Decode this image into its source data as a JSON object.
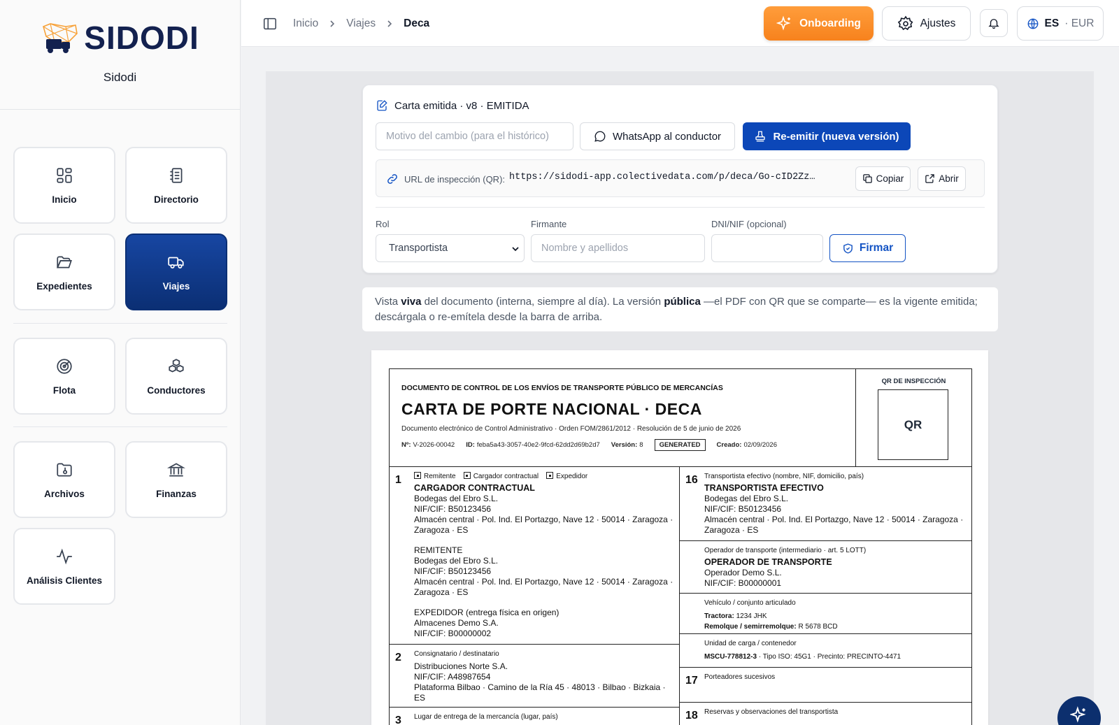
{
  "brand": {
    "name": "SIDODI",
    "org": "Sidodi"
  },
  "nav": {
    "tiles": [
      {
        "label": "Inicio",
        "icon": "dashboard-icon"
      },
      {
        "label": "Directorio",
        "icon": "directory-icon"
      },
      {
        "label": "Expedientes",
        "icon": "folder-open-icon"
      },
      {
        "label": "Viajes",
        "icon": "truck-icon",
        "active": true
      },
      {
        "label": "Flota",
        "icon": "radar-icon"
      },
      {
        "label": "Conductores",
        "icon": "boxes-icon"
      },
      {
        "label": "Archivos",
        "icon": "folder-file-icon"
      },
      {
        "label": "Finanzas",
        "icon": "bank-icon"
      },
      {
        "label": "Análisis Clientes",
        "icon": "activity-icon"
      }
    ]
  },
  "topbar": {
    "breadcrumb": [
      "Inicio",
      "Viajes",
      "Deca"
    ],
    "onboarding": "Onboarding",
    "settings": "Ajustes",
    "lang": "ES",
    "currency": "· EUR"
  },
  "card": {
    "title": "Carta emitida · v8 · EMITIDA",
    "reason_placeholder": "Motivo del cambio (para el histórico)",
    "whatsapp": "WhatsApp al conductor",
    "reissue": "Re-emitir (nueva versión)",
    "url_label": "URL de inspección (QR):",
    "url": "https://sidodi-app.colectivedata.com/p/deca/Go-cID2Zz…",
    "copy": "Copiar",
    "open": "Abrir",
    "rol_label": "Rol",
    "rol_value": "Transportista",
    "signer_label": "Firmante",
    "signer_placeholder": "Nombre y apellidos",
    "dni_label": "DNI/NIF (opcional)",
    "sign": "Firmar"
  },
  "note": {
    "t1": "Vista ",
    "b1": "viva",
    "t2": " del documento (interna, siempre al día). La versión ",
    "b2": "pública",
    "t3": " —el PDF con QR que se comparte— es la vigente emitida; descárgala o re-emítela desde la barra de arriba."
  },
  "doc": {
    "header_small": "DOCUMENTO DE CONTROL DE LOS ENVÍOS DE TRANSPORTE PÚBLICO DE MERCANCÍAS",
    "title": "CARTA DE PORTE NACIONAL · DECA",
    "desc": "Documento electrónico de Control Administrativo · Orden FOM/2861/2012 · Resolución de 5 de junio de 2026",
    "n_label": "Nº:",
    "n_value": "V-2026-00042",
    "id_label": "ID:",
    "id_value": "feba5a43-3057-40e2-9fcd-62dd2d69b2d7",
    "version_label": "Versión:",
    "version_value": "8",
    "status": "GENERATED",
    "created_label": "Creado:",
    "created_value": "02/09/2026",
    "qr_label": "QR DE INSPECCIÓN",
    "qr_text": "QR",
    "c1": {
      "num": "1",
      "opt1": "Remitente",
      "opt2": "Cargador contractual",
      "opt3": "Expedidor",
      "a_title": "CARGADOR CONTRACTUAL",
      "a_name": "Bodegas del Ebro S.L.",
      "a_nif": "NIF/CIF: B50123456",
      "a_addr": "Almacén central · Pol. Ind. El Portazgo, Nave 12 · 50014 · Zaragoza · Zaragoza · ES",
      "b_title": "REMITENTE",
      "b_name": "Bodegas del Ebro S.L.",
      "b_nif": "NIF/CIF: B50123456",
      "b_addr": "Almacén central · Pol. Ind. El Portazgo, Nave 12 · 50014 · Zaragoza · Zaragoza · ES",
      "c_title": "EXPEDIDOR (entrega física en origen)",
      "c_name": "Almacenes Demo S.A.",
      "c_nif": "NIF/CIF: B00000002"
    },
    "c2": {
      "num": "2",
      "label": "Consignatario / destinatario",
      "name": "Distribuciones Norte S.A.",
      "nif": "NIF/CIF: A48987654",
      "addr": "Plataforma Bilbao · Camino de la Ría 45 · 48013 · Bilbao · Bizkaia · ES"
    },
    "c3": {
      "num": "3",
      "label": "Lugar de entrega de la mercancía (lugar, país)"
    },
    "c16": {
      "num": "16",
      "label": "Transportista efectivo (nombre, NIF, domicilio, país)",
      "title": "TRANSPORTISTA EFECTIVO",
      "name": "Bodegas del Ebro S.L.",
      "nif": "NIF/CIF: B50123456",
      "addr": "Almacén central · Pol. Ind. El Portazgo, Nave 12 · 50014 · Zaragoza · Zaragoza · ES"
    },
    "op": {
      "label": "Operador de transporte (intermediario · art. 5 LOTT)",
      "title": "OPERADOR DE TRANSPORTE",
      "name": "Operador Demo S.L.",
      "nif": "NIF/CIF: B00000001"
    },
    "veh": {
      "label": "Vehículo / conjunto articulado",
      "tr_label": "Tractora:",
      "tr_value": "1234 JHK",
      "rem_label": "Remolque / semirremolque:",
      "rem_value": "R 5678 BCD"
    },
    "unit": {
      "label": "Unidad de carga / contenedor",
      "code": "MSCU-778812-3",
      "rest": " · Tipo ISO: 45G1 · Precinto: PRECINTO-4471"
    },
    "c17": {
      "num": "17",
      "label": "Porteadores sucesivos"
    },
    "c18": {
      "num": "18",
      "label": "Reservas y observaciones del transportista"
    }
  },
  "colors": {
    "primary": "#0c47b8",
    "accent": "#f7821d",
    "navy": "#13214f"
  }
}
